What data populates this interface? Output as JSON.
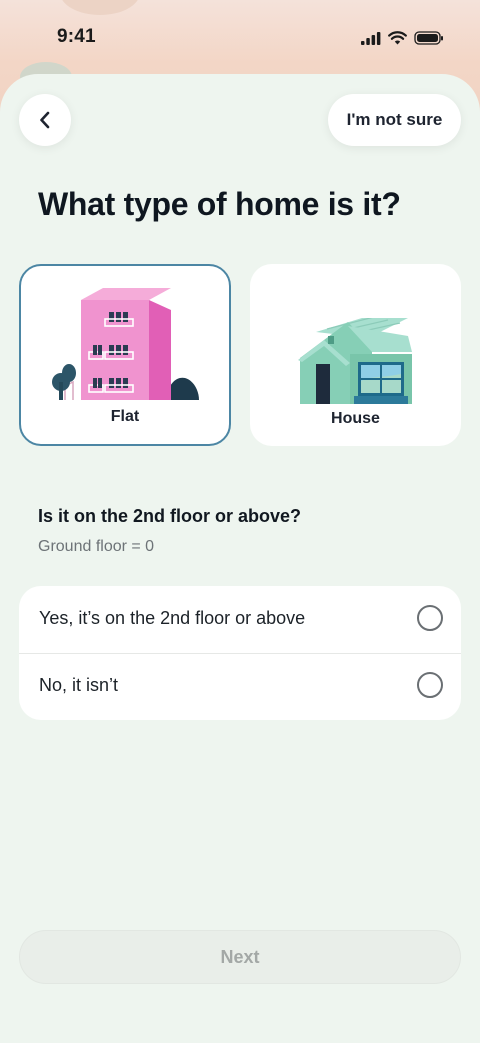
{
  "status_bar": {
    "time": "9:41"
  },
  "header": {
    "back_icon": "chevron-left-icon",
    "not_sure_label": "I'm not sure"
  },
  "title": "What type of home is it?",
  "home_types": [
    {
      "label": "Flat",
      "selected": true
    },
    {
      "label": "House",
      "selected": false
    }
  ],
  "floor_question": {
    "question": "Is it on the 2nd floor or above?",
    "hint": "Ground floor = 0",
    "options": [
      {
        "label": "Yes, it’s on the 2nd floor or above",
        "selected": false
      },
      {
        "label": "No, it isn’t",
        "selected": false
      }
    ]
  },
  "next_label": "Next",
  "colors": {
    "sheet_bg": "#eef5ef",
    "selected_border": "#4c86a4",
    "title_text": "#0f1720",
    "disabled_text": "#a3a8a6"
  }
}
